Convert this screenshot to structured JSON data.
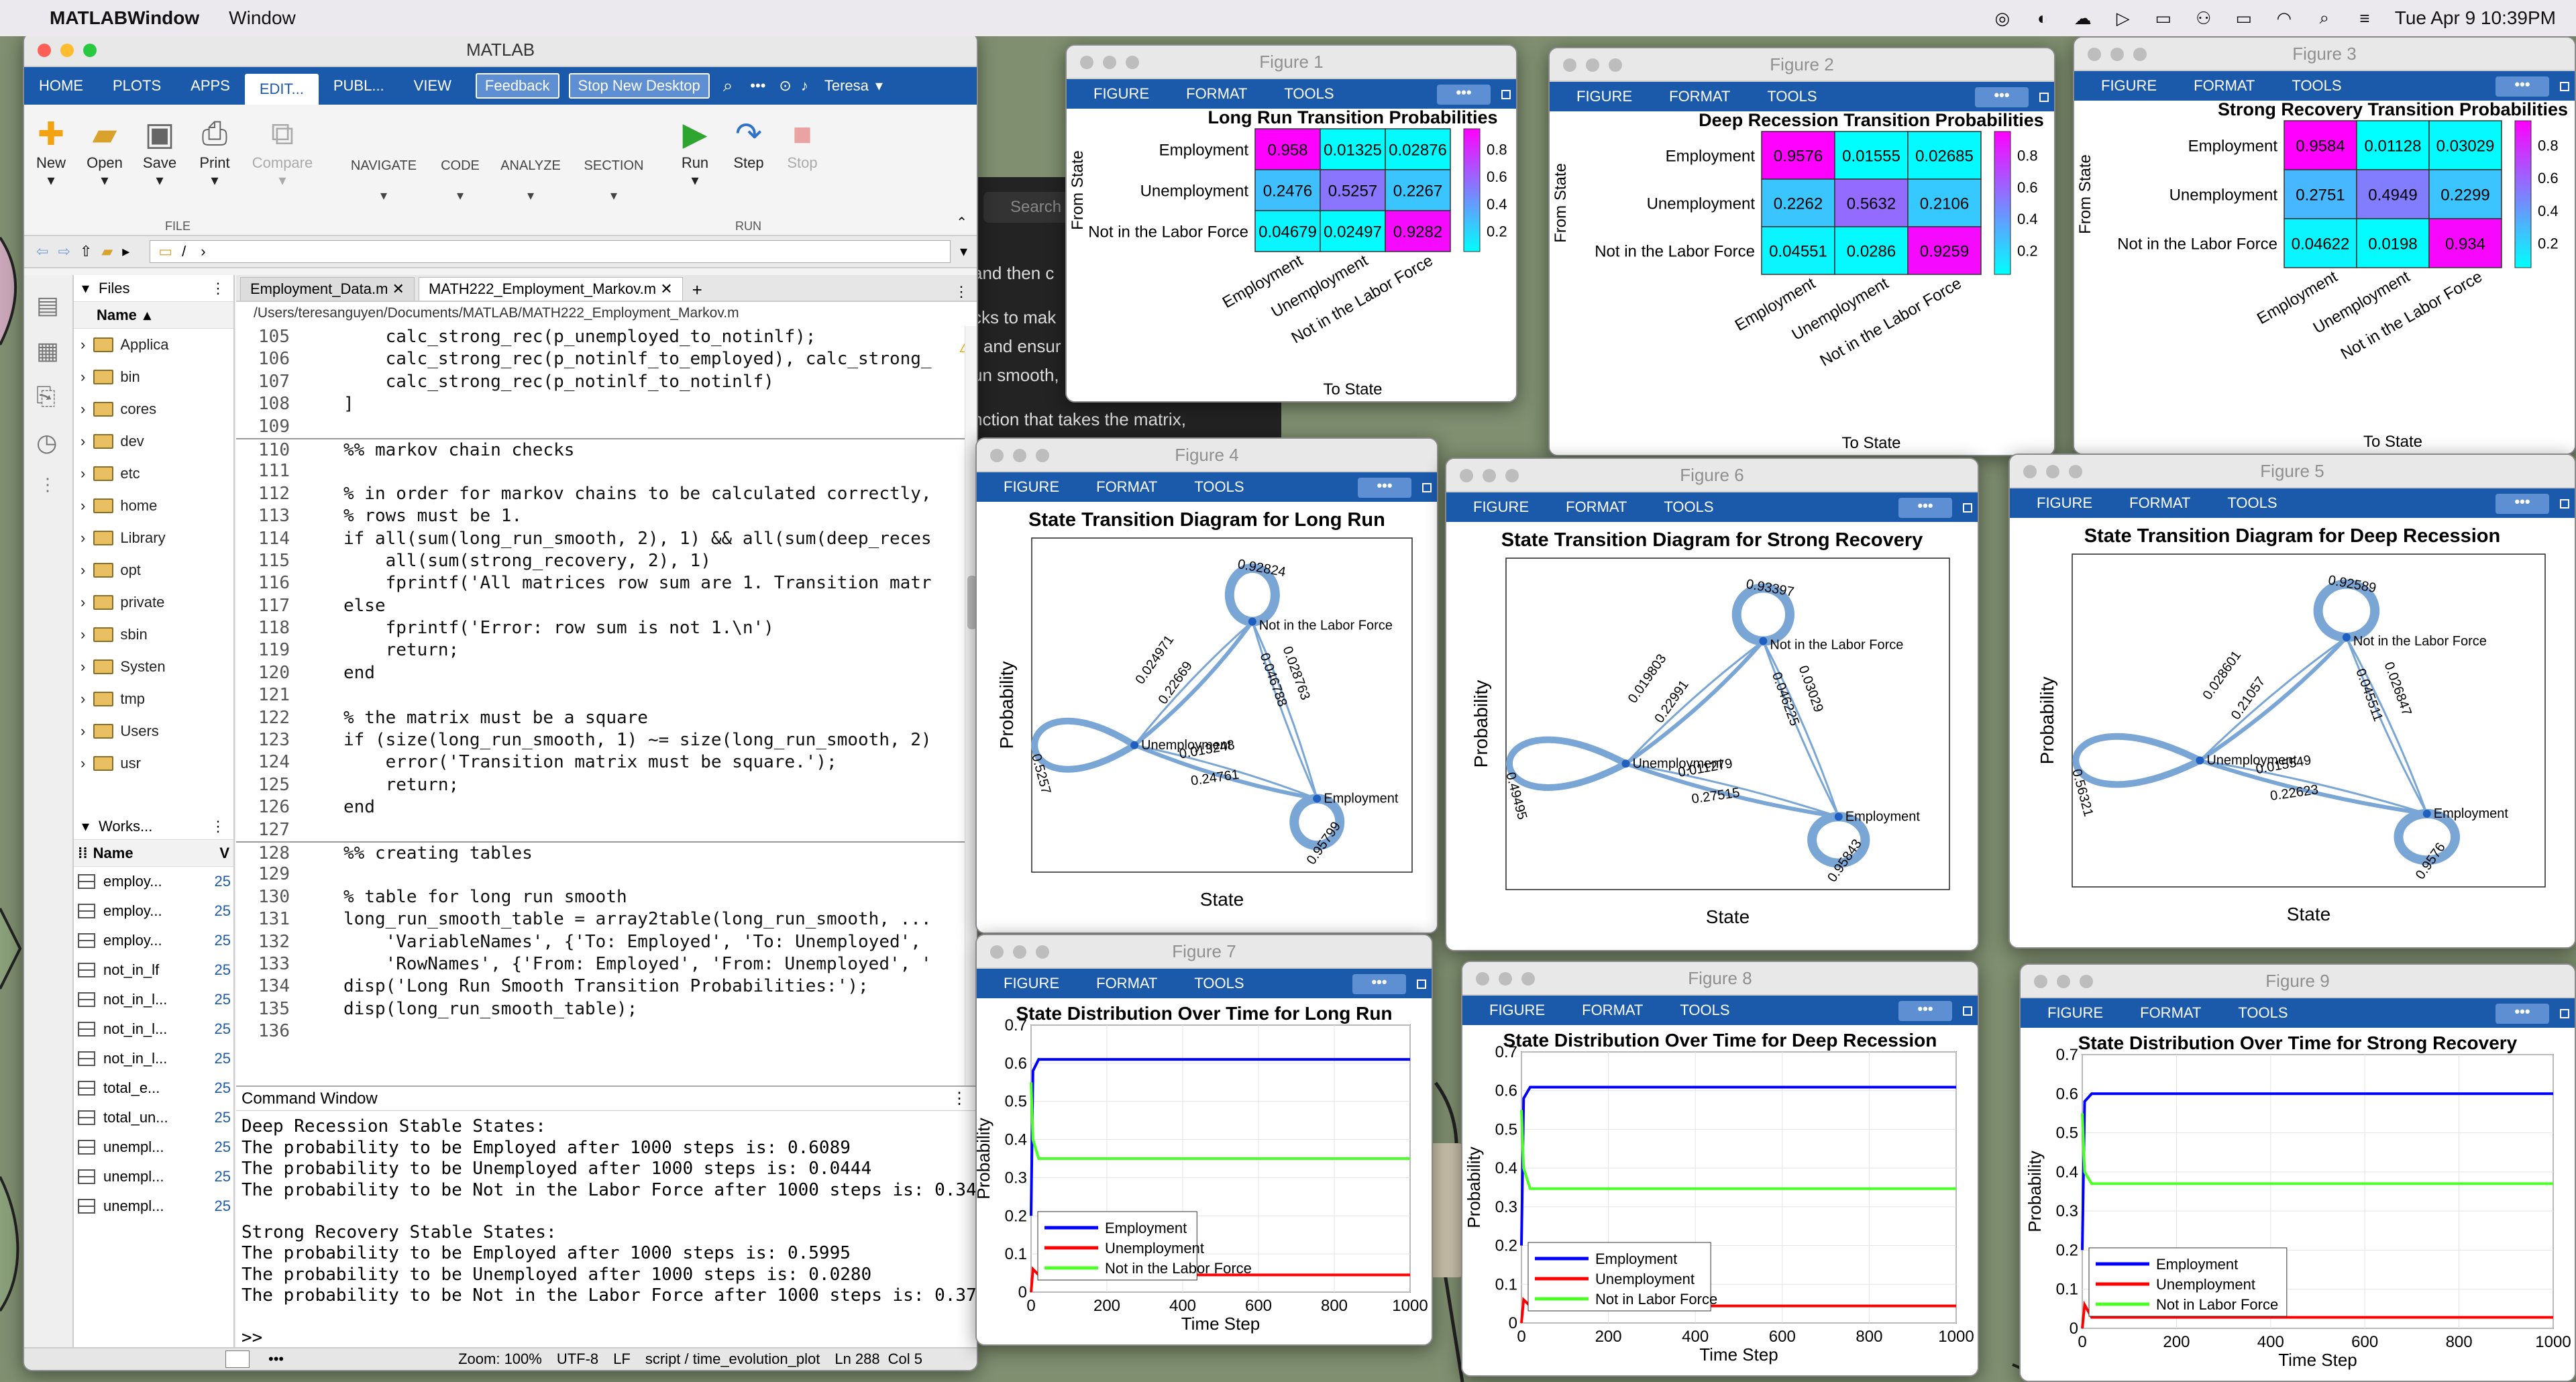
{
  "menubar": {
    "app": "MATLABWindow",
    "menu": "Window",
    "datetime": "Tue Apr 9  10:39PM"
  },
  "behind": {
    "search": "Search",
    "t1": "and then c",
    "t2": "cks to mak",
    "t3": ") and ensur",
    "t4": "un smooth,",
    "t5": "nction that takes the matrix,"
  },
  "matlab": {
    "title": "MATLAB",
    "tabs": [
      "HOME",
      "PLOTS",
      "APPS",
      "EDIT...",
      "PUBL...",
      "VIEW"
    ],
    "feedback": "Feedback",
    "stop_new_desktop": "Stop New Desktop",
    "user": "Teresa",
    "toolstrip": {
      "new": "New",
      "open": "Open",
      "save": "Save",
      "print": "Print",
      "compare": "Compare",
      "navigate": "NAVIGATE",
      "code": "CODE",
      "analyze": "ANALYZE",
      "section": "SECTION",
      "run": "Run",
      "step": "Step",
      "stop": "Stop",
      "file_group": "FILE",
      "run_group": "RUN"
    },
    "address": "/",
    "files_header": "Files",
    "name_col": "Name",
    "folders": [
      "Applica",
      "bin",
      "cores",
      "dev",
      "etc",
      "home",
      "Library",
      "opt",
      "private",
      "sbin",
      "Systen",
      "tmp",
      "Users",
      "usr"
    ],
    "workspace_header": "Works...",
    "ws_name": "Name",
    "ws_v": "V",
    "workspace": [
      {
        "name": "employ...",
        "val": "25"
      },
      {
        "name": "employ...",
        "val": "25"
      },
      {
        "name": "employ...",
        "val": "25"
      },
      {
        "name": "not_in_lf",
        "val": "25"
      },
      {
        "name": "not_in_l...",
        "val": "25"
      },
      {
        "name": "not_in_l...",
        "val": "25"
      },
      {
        "name": "not_in_l...",
        "val": "25"
      },
      {
        "name": "total_e...",
        "val": "25"
      },
      {
        "name": "total_un...",
        "val": "25"
      },
      {
        "name": "unempl...",
        "val": "25"
      },
      {
        "name": "unempl...",
        "val": "25"
      },
      {
        "name": "unempl...",
        "val": "25"
      }
    ],
    "editor_tabs": [
      "Employment_Data.m",
      "MATH222_Employment_Markov.m"
    ],
    "editor_path": "/Users/teresanguyen/Documents/MATLAB/MATH222_Employment_Markov.m",
    "code": [
      {
        "n": "105",
        "t": "    calc_strong_rec(p_unemployed_to_notinlf);",
        "c": ""
      },
      {
        "n": "106",
        "t": "    calc_strong_rec(p_notinlf_to_employed), calc_strong_",
        "c": ""
      },
      {
        "n": "107",
        "t": "    calc_strong_rec(p_notinlf_to_notinlf)",
        "c": ""
      },
      {
        "n": "108",
        "t": "]",
        "c": ""
      },
      {
        "n": "109",
        "t": "",
        "c": ""
      },
      {
        "n": "110",
        "t": "%% markov chain checks",
        "c": "cm sec"
      },
      {
        "n": "111",
        "t": "",
        "c": ""
      },
      {
        "n": "112",
        "t": "% in order for markov chains to be calculated correctly,",
        "c": "cm"
      },
      {
        "n": "113",
        "t": "% rows must be 1.",
        "c": "cm"
      },
      {
        "n": "114",
        "t": "if all(sum(long_run_smooth, 2), 1) && all(sum(deep_reces",
        "c": "if"
      },
      {
        "n": "115",
        "t": "    all(sum(strong_recovery, 2), 1)",
        "c": ""
      },
      {
        "n": "116",
        "t": "    fprintf('All matrices row sum are 1. Transition matr",
        "c": "str1"
      },
      {
        "n": "117",
        "t": "else",
        "c": "kw"
      },
      {
        "n": "118",
        "t": "    fprintf('Error: row sum is not 1.\\n')",
        "c": "str2"
      },
      {
        "n": "119",
        "t": "    return;",
        "c": "kw"
      },
      {
        "n": "120",
        "t": "end",
        "c": "kw"
      },
      {
        "n": "121",
        "t": "",
        "c": ""
      },
      {
        "n": "122",
        "t": "% the matrix must be a square",
        "c": "cm"
      },
      {
        "n": "123",
        "t": "if (size(long_run_smooth, 1) ~= size(long_run_smooth, 2)",
        "c": "if"
      },
      {
        "n": "124",
        "t": "    error('Transition matrix must be square.');",
        "c": "str3"
      },
      {
        "n": "125",
        "t": "    return;",
        "c": "kw"
      },
      {
        "n": "126",
        "t": "end",
        "c": "kw"
      },
      {
        "n": "127",
        "t": "",
        "c": ""
      },
      {
        "n": "128",
        "t": "%% creating tables",
        "c": "cm sec"
      },
      {
        "n": "129",
        "t": "",
        "c": ""
      },
      {
        "n": "130",
        "t": "% table for long run smooth",
        "c": "cm"
      },
      {
        "n": "131",
        "t": "long_run_smooth_table = array2table(long_run_smooth, ...",
        "c": "dots"
      },
      {
        "n": "132",
        "t": "    'VariableNames', {'To: Employed', 'To: Unemployed',",
        "c": "st"
      },
      {
        "n": "133",
        "t": "    'RowNames', {'From: Employed', 'From: Unemployed', '",
        "c": "st"
      },
      {
        "n": "134",
        "t": "disp('Long Run Smooth Transition Probabilities:');",
        "c": "str4"
      },
      {
        "n": "135",
        "t": "disp(long_run_smooth_table);",
        "c": ""
      },
      {
        "n": "136",
        "t": "",
        "c": ""
      }
    ],
    "cmd_title": "Command Window",
    "cmd": [
      "Deep Recession Stable States:",
      "The probability to be Employed after 1000 steps is: 0.6089",
      "The probability to be Unemployed after 1000 steps is: 0.0444",
      "The probability to be Not in the Labor Force after 1000 steps is: 0.34",
      "",
      "Strong Recovery Stable States:",
      "The probability to be Employed after 1000 steps is: 0.5995",
      "The probability to be Unemployed after 1000 steps is: 0.0280",
      "The probability to be Not in the Labor Force after 1000 steps is: 0.37",
      "",
      ">>"
    ],
    "status": {
      "zoom": "Zoom: 100%",
      "enc": "UTF-8",
      "eol": "LF",
      "script": "script / time_evolution_plot",
      "ln": "Ln  288",
      "col": "Col  5"
    }
  },
  "figtool": {
    "figure": "FIGURE",
    "format": "FORMAT",
    "tools": "TOOLS",
    "dots": "•••"
  },
  "states": [
    "Employment",
    "Unemployment",
    "Not in the Labor Force"
  ],
  "heat_ylabel": "From State",
  "heat_xlabel": "To State",
  "fig1": {
    "title": "Figure 1",
    "plot": "Long Run Transition Probabilities",
    "cells": [
      [
        "0.958",
        "0.01325",
        "0.02876"
      ],
      [
        "0.2476",
        "0.5257",
        "0.2267"
      ],
      [
        "0.04679",
        "0.02497",
        "0.9282"
      ]
    ],
    "cb": [
      "0.8",
      "0.6",
      "0.4",
      "0.2"
    ]
  },
  "fig2": {
    "title": "Figure 2",
    "plot": "Deep Recession Transition Probabilities",
    "cells": [
      [
        "0.9576",
        "0.01555",
        "0.02685"
      ],
      [
        "0.2262",
        "0.5632",
        "0.2106"
      ],
      [
        "0.04551",
        "0.0286",
        "0.9259"
      ]
    ],
    "cb": [
      "0.8",
      "0.6",
      "0.4",
      "0.2"
    ]
  },
  "fig3": {
    "title": "Figure 3",
    "plot": "Strong Recovery Transition Probabilities",
    "cells": [
      [
        "0.9584",
        "0.01128",
        "0.03029"
      ],
      [
        "0.2751",
        "0.4949",
        "0.2299"
      ],
      [
        "0.04622",
        "0.0198",
        "0.934"
      ]
    ],
    "cb": [
      "0.8",
      "0.6",
      "0.4",
      "0.2"
    ]
  },
  "graph_ylabel": "Probability",
  "graph_xlabel": "State",
  "fig4": {
    "title": "Figure 4",
    "plot": "State Transition Diagram for Long Run",
    "nodes": [
      "Not in the Labor Force",
      "Unemployment",
      "Employment"
    ],
    "edges": {
      "loopNIL": "0.92824",
      "nilToU": "0.024971",
      "uToNil": "0.22669",
      "nilToE": "0.046788",
      "eToNil": "0.028763",
      "loopU": "0.5257",
      "uToE": "0.013248",
      "eToU": "0.24761",
      "loopE": "0.95799"
    }
  },
  "fig6": {
    "title": "Figure 6",
    "plot": "State Transition Diagram for Strong Recovery",
    "nodes": [
      "Not in the Labor Force",
      "Unemployment",
      "Employment"
    ],
    "edges": {
      "loopNIL": "0.93397",
      "nilToU": "0.019803",
      "uToNil": "0.22991",
      "nilToE": "0.046225",
      "eToNil": "0.03029",
      "loopU": "0.49495",
      "uToE": "0.011279",
      "eToU": "0.27515",
      "loopE": "0.95843"
    }
  },
  "fig5": {
    "title": "Figure 5",
    "plot": "State Transition Diagram for Deep Recession",
    "nodes": [
      "Not in the Labor Force",
      "Unemployment",
      "Employment"
    ],
    "edges": {
      "loopNIL": "0.92589",
      "nilToU": "0.028601",
      "uToNil": "0.21057",
      "nilToE": "0.045511",
      "eToNil": "0.026847",
      "loopU": "0.56321",
      "uToE": "0.015549",
      "eToU": "0.22623",
      "loopE": "0.9576"
    }
  },
  "line_xlabel": "Time Step",
  "line_ylabel": "Probability",
  "fig7": {
    "title": "Figure 7",
    "plot": "State Distribution Over Time for Long Run",
    "legend": [
      "Employment",
      "Unemployment",
      "Not in the Labor Force"
    ],
    "xticks": [
      "0",
      "200",
      "400",
      "600",
      "800",
      "1000"
    ],
    "yticks": [
      "0",
      "0.1",
      "0.2",
      "0.3",
      "0.4",
      "0.5",
      "0.6",
      "0.7"
    ]
  },
  "fig8": {
    "title": "Figure 8",
    "plot": "State Distribution Over Time for Deep Recession",
    "legend": [
      "Employment",
      "Unemployment",
      "Not in Labor Force"
    ],
    "xticks": [
      "0",
      "200",
      "400",
      "600",
      "800",
      "1000"
    ],
    "yticks": [
      "0",
      "0.1",
      "0.2",
      "0.3",
      "0.4",
      "0.5",
      "0.6",
      "0.7"
    ]
  },
  "fig9": {
    "title": "Figure 9",
    "plot": "State Distribution Over Time for Strong Recovery",
    "legend": [
      "Employment",
      "Unemployment",
      "Not in Labor Force"
    ],
    "xticks": [
      "0",
      "200",
      "400",
      "600",
      "800",
      "1000"
    ],
    "yticks": [
      "0",
      "0.1",
      "0.2",
      "0.3",
      "0.4",
      "0.5",
      "0.6",
      "0.7"
    ]
  },
  "colors": {
    "matlabBlue": "#1b5aab",
    "employment": "#0000ff",
    "unemployment": "#ff0000",
    "notinlf": "#4cff26",
    "edge": "#7aa6d6"
  },
  "chart_data": [
    {
      "type": "heatmap",
      "title": "Long Run Transition Probabilities",
      "xlabel": "To State",
      "ylabel": "From State",
      "x": [
        "Employment",
        "Unemployment",
        "Not in the Labor Force"
      ],
      "y": [
        "Employment",
        "Unemployment",
        "Not in the Labor Force"
      ],
      "values": [
        [
          0.958,
          0.01325,
          0.02876
        ],
        [
          0.2476,
          0.5257,
          0.2267
        ],
        [
          0.04679,
          0.02497,
          0.9282
        ]
      ]
    },
    {
      "type": "heatmap",
      "title": "Deep Recession Transition Probabilities",
      "xlabel": "To State",
      "ylabel": "From State",
      "x": [
        "Employment",
        "Unemployment",
        "Not in the Labor Force"
      ],
      "y": [
        "Employment",
        "Unemployment",
        "Not in the Labor Force"
      ],
      "values": [
        [
          0.9576,
          0.01555,
          0.02685
        ],
        [
          0.2262,
          0.5632,
          0.2106
        ],
        [
          0.04551,
          0.0286,
          0.9259
        ]
      ]
    },
    {
      "type": "heatmap",
      "title": "Strong Recovery Transition Probabilities",
      "xlabel": "To State",
      "ylabel": "From State",
      "x": [
        "Employment",
        "Unemployment",
        "Not in the Labor Force"
      ],
      "y": [
        "Employment",
        "Unemployment",
        "Not in the Labor Force"
      ],
      "values": [
        [
          0.9584,
          0.01128,
          0.03029
        ],
        [
          0.2751,
          0.4949,
          0.2299
        ],
        [
          0.04622,
          0.0198,
          0.934
        ]
      ]
    },
    {
      "type": "line",
      "title": "State Distribution Over Time for Long Run",
      "xlabel": "Time Step",
      "ylabel": "Probability",
      "xlim": [
        0,
        1000
      ],
      "ylim": [
        0,
        0.7
      ],
      "series": [
        {
          "name": "Employment",
          "x": [
            0,
            5,
            20,
            1000
          ],
          "values": [
            0.2,
            0.58,
            0.61,
            0.61
          ]
        },
        {
          "name": "Unemployment",
          "x": [
            0,
            5,
            20,
            1000
          ],
          "values": [
            0.0,
            0.06,
            0.045,
            0.045
          ]
        },
        {
          "name": "Not in the Labor Force",
          "x": [
            0,
            5,
            20,
            1000
          ],
          "values": [
            0.55,
            0.4,
            0.35,
            0.35
          ]
        }
      ]
    },
    {
      "type": "line",
      "title": "State Distribution Over Time for Deep Recession",
      "xlabel": "Time Step",
      "ylabel": "Probability",
      "xlim": [
        0,
        1000
      ],
      "ylim": [
        0,
        0.7
      ],
      "series": [
        {
          "name": "Employment",
          "x": [
            0,
            5,
            20,
            1000
          ],
          "values": [
            0.2,
            0.58,
            0.609,
            0.609
          ]
        },
        {
          "name": "Unemployment",
          "x": [
            0,
            5,
            20,
            1000
          ],
          "values": [
            0.0,
            0.06,
            0.044,
            0.044
          ]
        },
        {
          "name": "Not in Labor Force",
          "x": [
            0,
            5,
            20,
            1000
          ],
          "values": [
            0.55,
            0.4,
            0.347,
            0.347
          ]
        }
      ]
    },
    {
      "type": "line",
      "title": "State Distribution Over Time for Strong Recovery",
      "xlabel": "Time Step",
      "ylabel": "Probability",
      "xlim": [
        0,
        1000
      ],
      "ylim": [
        0,
        0.7
      ],
      "series": [
        {
          "name": "Employment",
          "x": [
            0,
            5,
            20,
            1000
          ],
          "values": [
            0.2,
            0.58,
            0.6,
            0.6
          ]
        },
        {
          "name": "Unemployment",
          "x": [
            0,
            5,
            20,
            1000
          ],
          "values": [
            0.0,
            0.06,
            0.028,
            0.028
          ]
        },
        {
          "name": "Not in Labor Force",
          "x": [
            0,
            5,
            20,
            1000
          ],
          "values": [
            0.55,
            0.4,
            0.37,
            0.37
          ]
        }
      ]
    }
  ]
}
